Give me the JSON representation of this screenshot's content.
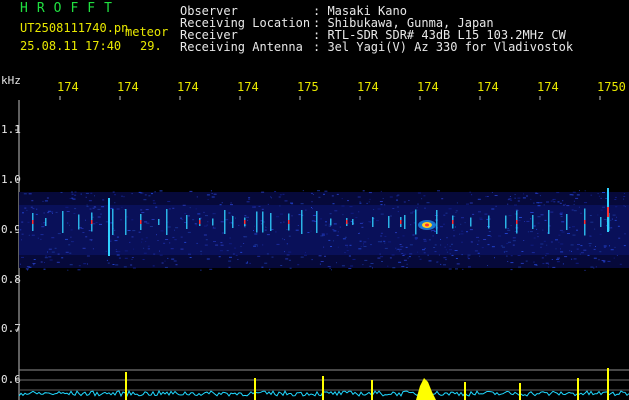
{
  "header": {
    "logo": "HROFFT",
    "filename": "UT2508111740.pn",
    "type": "meteor",
    "datetime": "25.08.11 17:40",
    "count": "29.",
    "info": [
      {
        "label": "Observer",
        "value": ": Masaki Kano"
      },
      {
        "label": "Receiving Location",
        "value": ": Shibukawa, Gunma, Japan"
      },
      {
        "label": "Receiver",
        "value": ": RTL-SDR SDR# 43dB L15 103.2MHz CW"
      },
      {
        "label": "Receiving Antenna",
        "value": ": 3el Yagi(V) Az 330 for Vladivostok"
      }
    ]
  },
  "axis": {
    "unit": "kHz",
    "time_ticks": [
      "174",
      "174",
      "174",
      "174",
      "175",
      "174",
      "174",
      "174",
      "174",
      "1750"
    ],
    "freq_ticks": [
      "1.1",
      "1.0",
      "0.9",
      "0.8",
      "0.7",
      "0.6"
    ]
  },
  "colors": {
    "header_green": "#20e040",
    "header_white": "#e8e8e8",
    "tick_yellow": "#e8e800",
    "band_blue": "#1a2a9a",
    "echo_cyan": "#30d0ff",
    "echo_red": "#ff3030",
    "level_cyan": "#20d8ff",
    "level_yellow": "#ffff00"
  }
}
